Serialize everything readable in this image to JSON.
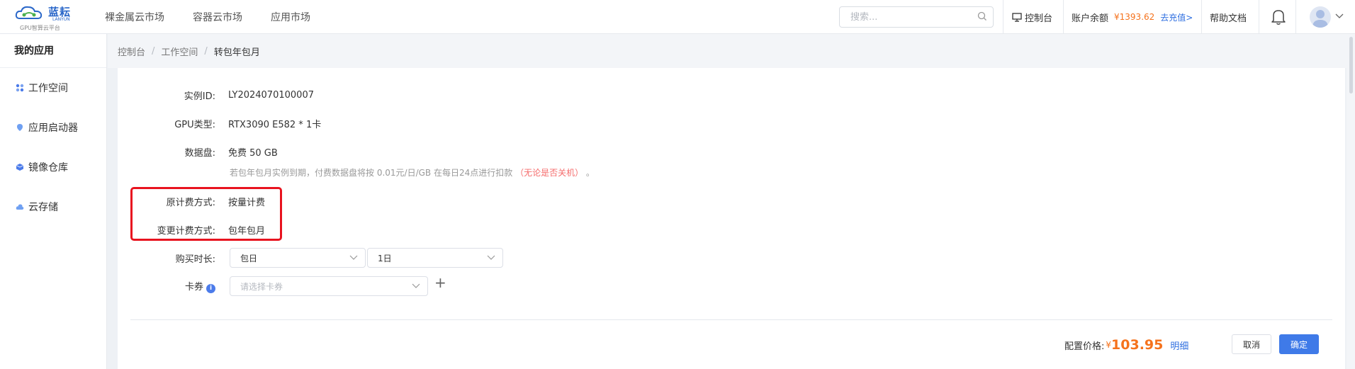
{
  "header": {
    "brand": "蓝耘",
    "brand_en": "LANYUN",
    "slogan": "GPU智算云平台",
    "nav": [
      "裸金属云市场",
      "容器云市场",
      "应用市场"
    ],
    "search_placeholder": "搜索...",
    "console": "控制台",
    "balance_label": "账户余额",
    "balance_amount": "¥1393.62",
    "recharge": "去充值>",
    "help": "帮助文档"
  },
  "sidebar": {
    "title": "我的应用",
    "items": [
      {
        "label": "工作空间",
        "icon": "workspace-icon"
      },
      {
        "label": "应用启动器",
        "icon": "launcher-icon"
      },
      {
        "label": "镜像仓库",
        "icon": "image-repo-icon"
      },
      {
        "label": "云存储",
        "icon": "cloud-storage-icon"
      }
    ]
  },
  "breadcrumb": [
    "控制台",
    "工作空间",
    "转包年包月"
  ],
  "form": {
    "instance_id": {
      "label": "实例ID:",
      "value": "LY2024070100007"
    },
    "gpu_type": {
      "label": "GPU类型:",
      "value": "RTX3090 E582 * 1卡"
    },
    "disk": {
      "label": "数据盘:",
      "value": "免费 50 GB"
    },
    "disk_note": "若包年包月实例到期，付费数据盘将按 0.01元/日/GB 在每日24点进行扣款",
    "disk_note_red": "（无论是否关机）",
    "disk_note_end": "。",
    "orig_billing": {
      "label": "原计费方式:",
      "value": "按量计费"
    },
    "new_billing": {
      "label": "变更计费方式:",
      "value": "包年包月"
    },
    "duration": {
      "label": "购买时长:",
      "unit": "包日",
      "amount": "1日"
    },
    "coupon": {
      "label": "卡券",
      "placeholder": "请选择卡券"
    }
  },
  "footer": {
    "price_label": "配置价格:",
    "currency": "¥",
    "price": "103.95",
    "detail": "明细",
    "cancel": "取消",
    "confirm": "确定"
  },
  "colors": {
    "accent": "#3f7ae8",
    "price": "#f5721c",
    "highlight": "#e8131f"
  }
}
